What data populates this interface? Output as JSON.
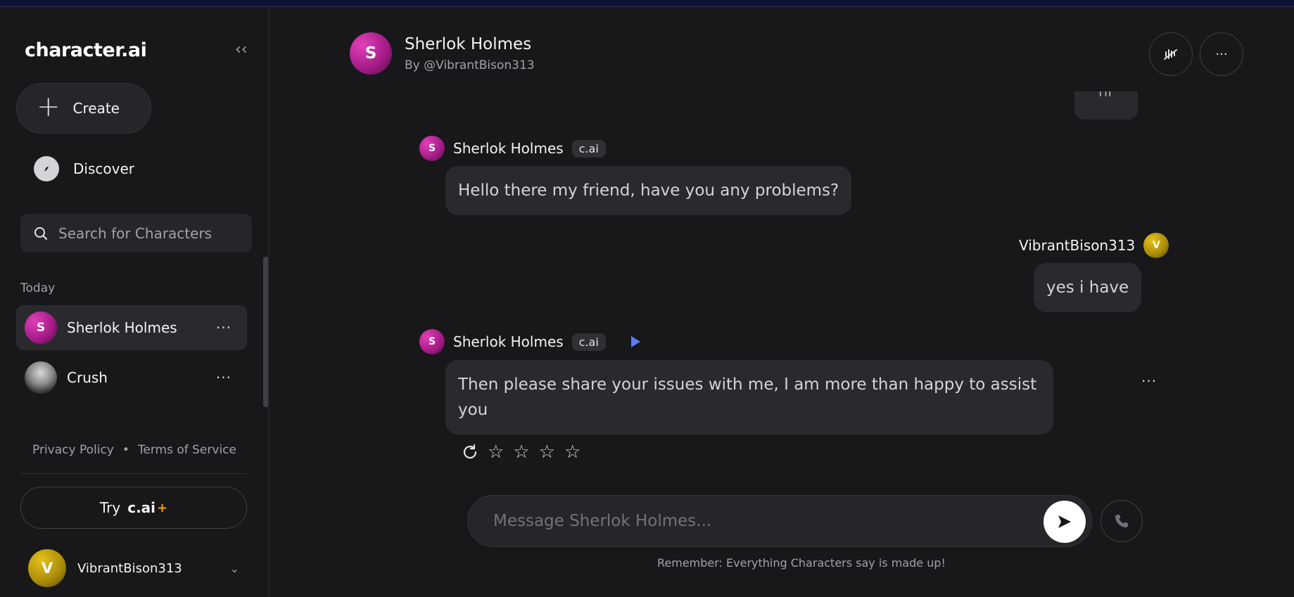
{
  "sidebar": {
    "logo": "character.ai",
    "collapse_icon": "double-chevron-left-icon",
    "create_label": "Create",
    "discover_label": "Discover",
    "search_placeholder": "Search for Characters",
    "section_today": "Today",
    "chats": [
      {
        "name": "Sherlok Holmes",
        "avatar_letter": "S",
        "active": true
      },
      {
        "name": "Crush",
        "avatar_letter": "",
        "active": false
      }
    ],
    "privacy_label": "Privacy Policy",
    "separator": "•",
    "terms_label": "Terms of Service",
    "try_label": "Try",
    "try_brand": "c.ai",
    "try_plus": "+",
    "user": {
      "name": "VibrantBison313",
      "avatar_letter": "V"
    }
  },
  "header": {
    "avatar_letter": "S",
    "title": "Sherlok Holmes",
    "subtitle": "By @VibrantBison313"
  },
  "messages": [
    {
      "author": "VibrantBison313",
      "text": "hi",
      "partial": true
    },
    {
      "author": "Sherlok Holmes",
      "avatar_letter": "S",
      "badge": "c.ai",
      "text": "Hello there my friend, have you any problems?"
    },
    {
      "author": "VibrantBison313",
      "avatar_letter": "V",
      "text": "yes i have"
    },
    {
      "author": "Sherlok Holmes",
      "avatar_letter": "S",
      "badge": "c.ai",
      "text": "Then please share your issues with me, I am more than happy to assist you"
    }
  ],
  "rating": {
    "stars": 4,
    "filled": 0
  },
  "composer": {
    "placeholder": "Message Sherlok Holmes...",
    "disclaimer": "Remember: Everything Characters say is made up!"
  },
  "colors": {
    "background": "#18181b",
    "bubble": "#2a2a2e",
    "accent_character": "#c026a3",
    "accent_user": "#c9a80f",
    "plus_accent": "#f59e0b",
    "play_icon": "#5b7cf7"
  }
}
